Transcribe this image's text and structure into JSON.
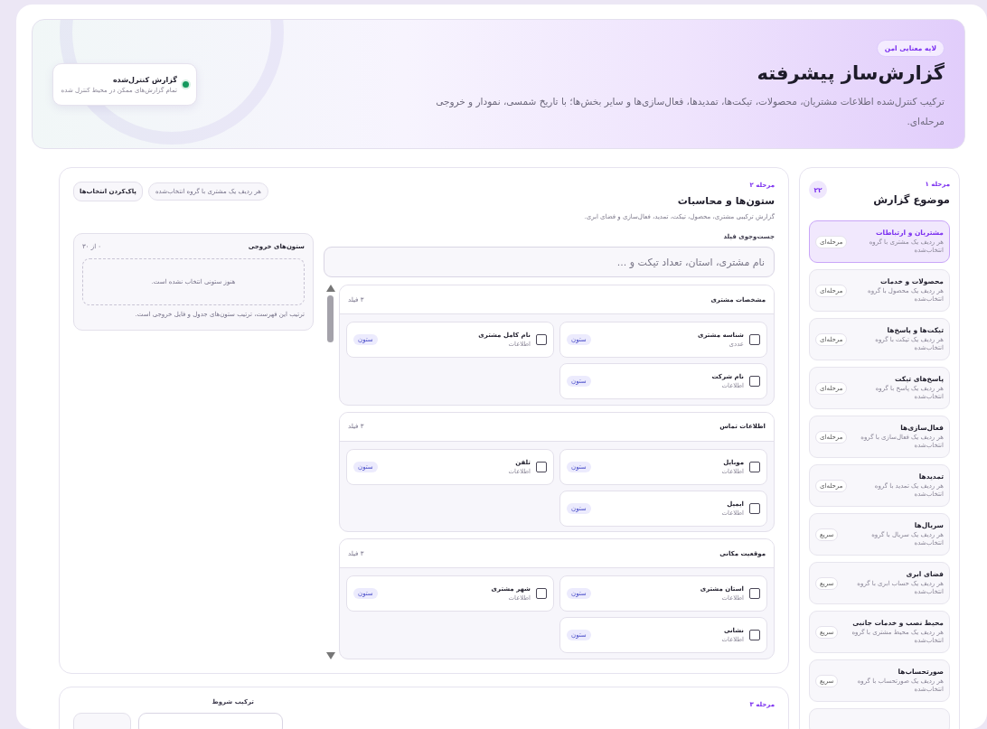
{
  "header": {
    "badge": "لایه معنایی امن",
    "title": "گزارش‌ساز پیشرفته",
    "description": "ترکیب کنترل‌شده اطلاعات مشتریان، محصولات، تیکت‌ها، تمدیدها، فعال‌سازی‌ها و سایر بخش‌ها؛ با تاریخ شمسی، نمودار و خروجی مرحله‌ای.",
    "status_card": {
      "title": "گزارش کنترل‌شده",
      "subtitle": "تمام گزارش‌های ممکن در محیط کنترل شده",
      "on": true
    }
  },
  "sidebar": {
    "step": "مرحله ۱",
    "title": "موضوع گزارش",
    "count": "۲۲",
    "items": [
      {
        "title": "مشتریان و ارتباطات",
        "subtitle": "هر ردیف یک مشتری با گروه انتخاب‌شده",
        "tag": "مرحله‌ای",
        "selected": true
      },
      {
        "title": "محصولات و خدمات",
        "subtitle": "هر ردیف یک محصول با گروه انتخاب‌شده",
        "tag": "مرحله‌ای",
        "selected": false
      },
      {
        "title": "تیکت‌ها و پاسخ‌ها",
        "subtitle": "هر ردیف یک تیکت با گروه انتخاب‌شده",
        "tag": "مرحله‌ای",
        "selected": false
      },
      {
        "title": "پاسخ‌های تیکت",
        "subtitle": "هر ردیف یک پاسخ با گروه انتخاب‌شده",
        "tag": "مرحله‌ای",
        "selected": false
      },
      {
        "title": "فعال‌سازی‌ها",
        "subtitle": "هر ردیف یک فعال‌سازی با گروه انتخاب‌شده",
        "tag": "مرحله‌ای",
        "selected": false
      },
      {
        "title": "تمدیدها",
        "subtitle": "هر ردیف یک تمدید با گروه انتخاب‌شده",
        "tag": "مرحله‌ای",
        "selected": false
      },
      {
        "title": "سریال‌ها",
        "subtitle": "هر ردیف یک سریال با گروه انتخاب‌شده",
        "tag": "سریع",
        "selected": false
      },
      {
        "title": "فضای ابری",
        "subtitle": "هر ردیف یک حساب ابری با گروه انتخاب‌شده",
        "tag": "سریع",
        "selected": false
      },
      {
        "title": "محیط نصب و خدمات جانبی",
        "subtitle": "هر ردیف یک محیط مشتری با گروه انتخاب‌شده",
        "tag": "سریع",
        "selected": false
      },
      {
        "title": "صورتحساب‌ها",
        "subtitle": "هر ردیف یک صورتحساب با گروه انتخاب‌شده",
        "tag": "سریع",
        "selected": false
      }
    ]
  },
  "columns_panel": {
    "step": "مرحله ۲",
    "title": "ستون‌ها و محاسبات",
    "description": "گزارش ترکیبی مشتری، محصول، تیکت، تمدید، فعال‌سازی و فضای ابری.",
    "scope_pill": "هر ردیف یک مشتری با گروه انتخاب‌شده",
    "clear_button": "پاک‌کردن انتخاب‌ها",
    "search": {
      "label": "جست‌وجوی فیلد",
      "placeholder": "نام مشتری، استان، تعداد تیکت و ..."
    },
    "groups": [
      {
        "title": "مشخصات مشتری",
        "count": "۳ فیلد",
        "fields": [
          {
            "name": "شناسه مشتری",
            "type": "عددی",
            "tag": "ستون",
            "checked": false
          },
          {
            "name": "نام کامل مشتری",
            "type": "اطلاعات",
            "tag": "ستون",
            "checked": false
          },
          {
            "name": "نام شرکت",
            "type": "اطلاعات",
            "tag": "ستون",
            "checked": false
          }
        ]
      },
      {
        "title": "اطلاعات تماس",
        "count": "۳ فیلد",
        "fields": [
          {
            "name": "موبایل",
            "type": "اطلاعات",
            "tag": "ستون",
            "checked": false
          },
          {
            "name": "تلفن",
            "type": "اطلاعات",
            "tag": "ستون",
            "checked": false
          },
          {
            "name": "ایمیل",
            "type": "اطلاعات",
            "tag": "ستون",
            "checked": false
          }
        ]
      },
      {
        "title": "موقعیت مکانی",
        "count": "۳ فیلد",
        "fields": [
          {
            "name": "استان مشتری",
            "type": "اطلاعات",
            "tag": "ستون",
            "checked": false
          },
          {
            "name": "شهر مشتری",
            "type": "اطلاعات",
            "tag": "ستون",
            "checked": false
          },
          {
            "name": "نشانی",
            "type": "اطلاعات",
            "tag": "ستون",
            "checked": false
          }
        ]
      }
    ],
    "output": {
      "title": "ستون‌های خروجی",
      "count": "۰ از ۳۰",
      "empty_text": "هنوز ستونی انتخاب نشده است.",
      "hint": "ترتیب این فهرست، ترتیب ستون‌های جدول و فایل خروجی است."
    }
  },
  "conditions_panel": {
    "step": "مرحله ۳",
    "label": "ترکیب شروط"
  }
}
